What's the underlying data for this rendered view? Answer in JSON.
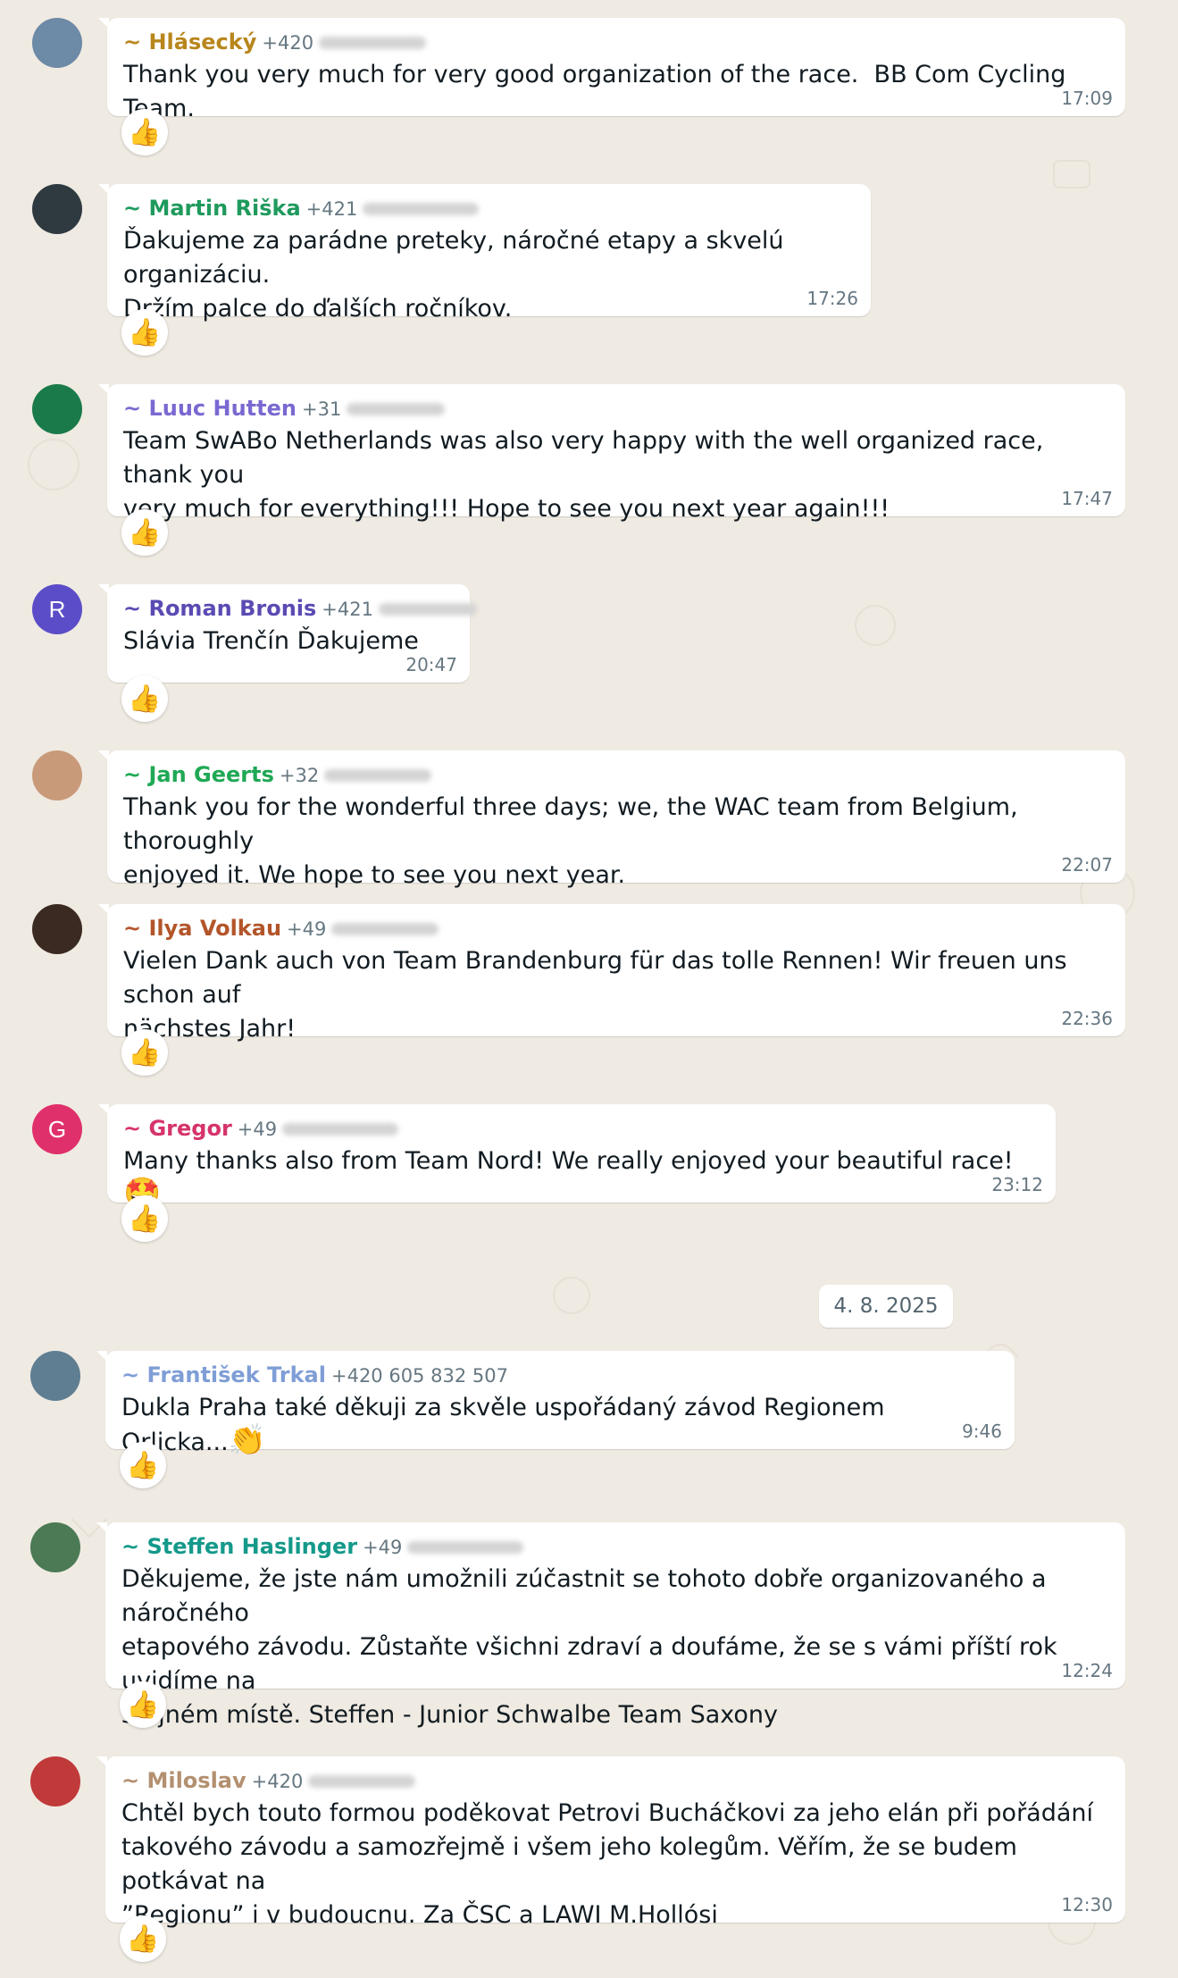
{
  "colors": {
    "background": "#efeae2",
    "bubble": "#ffffff",
    "meta_text": "#667781"
  },
  "date_separator": "4. 8. 2025",
  "messages": [
    {
      "sender": "~ Hlásecký",
      "name_color": "#b8861b",
      "phone_prefix": "+420",
      "text": "Thank you very much for very good organization of the race.  BB Com Cycling Team.",
      "time": "17:09",
      "reaction": "👍",
      "avatar": {
        "type": "photo",
        "color": "#6d8aa6"
      }
    },
    {
      "sender": "~ Martin Riška",
      "name_color": "#1f9a5d",
      "phone_prefix": "+421",
      "text": "Ďakujeme za parádne preteky, náročné etapy a skvelú organizáciu.\nDržím palce do ďalších ročníkov.",
      "time": "17:26",
      "reaction": "👍",
      "avatar": {
        "type": "photo",
        "color": "#2f3a40"
      }
    },
    {
      "sender": "~ Luuc Hutten",
      "name_color": "#7b68d1",
      "phone_prefix": "+31",
      "text": "Team SwABo Netherlands was also very happy with the well organized race, thank you\nvery much for everything!!! Hope to see you next year again!!!",
      "time": "17:47",
      "reaction": "👍",
      "avatar": {
        "type": "logo",
        "color": "#1a7a4a"
      }
    },
    {
      "sender": "~ Roman Bronis",
      "name_color": "#5a4bb3",
      "phone_prefix": "+421",
      "text": "Slávia Trenčín Ďakujeme",
      "time": "20:47",
      "reaction": "👍",
      "avatar": {
        "type": "letter",
        "letter": "R",
        "color": "#5b4dc7"
      }
    },
    {
      "sender": "~ Jan Geerts",
      "name_color": "#1fa855",
      "phone_prefix": "+32",
      "text": "Thank you for the wonderful three days; we, the WAC team from Belgium, thoroughly\nenjoyed it. We hope to see you next year.",
      "time": "22:07",
      "reaction": "",
      "avatar": {
        "type": "photo",
        "color": "#c99a7a"
      }
    },
    {
      "sender": "~ Ilya Volkau",
      "name_color": "#b3552a",
      "phone_prefix": "+49",
      "text": "Vielen Dank auch von Team Brandenburg für das tolle Rennen! Wir freuen uns schon auf\nnächstes Jahr!",
      "time": "22:36",
      "reaction": "👍",
      "avatar": {
        "type": "photo",
        "color": "#3a2a22"
      }
    },
    {
      "sender": "~ Gregor",
      "name_color": "#d6336c",
      "phone_prefix": "+49",
      "text": "Many thanks also from Team Nord! We really enjoyed your beautiful race! ",
      "inline_emoji": "🤩",
      "time": "23:12",
      "reaction": "👍",
      "avatar": {
        "type": "letter",
        "letter": "G",
        "color": "#e0306b"
      }
    },
    {
      "sender": "~ František Trkal",
      "name_color": "#7f9ed6",
      "phone_prefix": "+420 605 832 507",
      "text": "Dukla Praha také děkuji za skvěle uspořádaný závod Regionem Orlicka...",
      "inline_emoji": "👏",
      "time": "9:46",
      "reaction": "👍",
      "avatar": {
        "type": "photo",
        "color": "#5f7e92"
      }
    },
    {
      "sender": "~ Steffen Haslinger",
      "name_color": "#14998a",
      "phone_prefix": "+49",
      "text": "Děkujeme, že jste nám umožnili zúčastnit se tohoto dobře organizovaného a náročného\netapového závodu. Zůstaňte všichni zdraví a doufáme, že se s vámi příští rok uvidíme na\nstejném místě. Steffen - Junior Schwalbe Team Saxony",
      "time": "12:24",
      "reaction": "👍",
      "avatar": {
        "type": "photo",
        "color": "#4b7a55"
      }
    },
    {
      "sender": "~ Miloslav",
      "name_color": "#b39070",
      "phone_prefix": "+420",
      "text": "Chtěl bych touto formou poděkovat Petrovi Bucháčkovi za jeho elán při pořádání\ntakového závodu a samozřejmě i všem jeho kolegům. Věřím, že se budem potkávat na\n”Regionu” i v budoucnu. Za ČSC a LAWI M.Hollósi",
      "time": "12:30",
      "reaction": "👍",
      "avatar": {
        "type": "photo",
        "color": "#c03a3a"
      }
    }
  ]
}
